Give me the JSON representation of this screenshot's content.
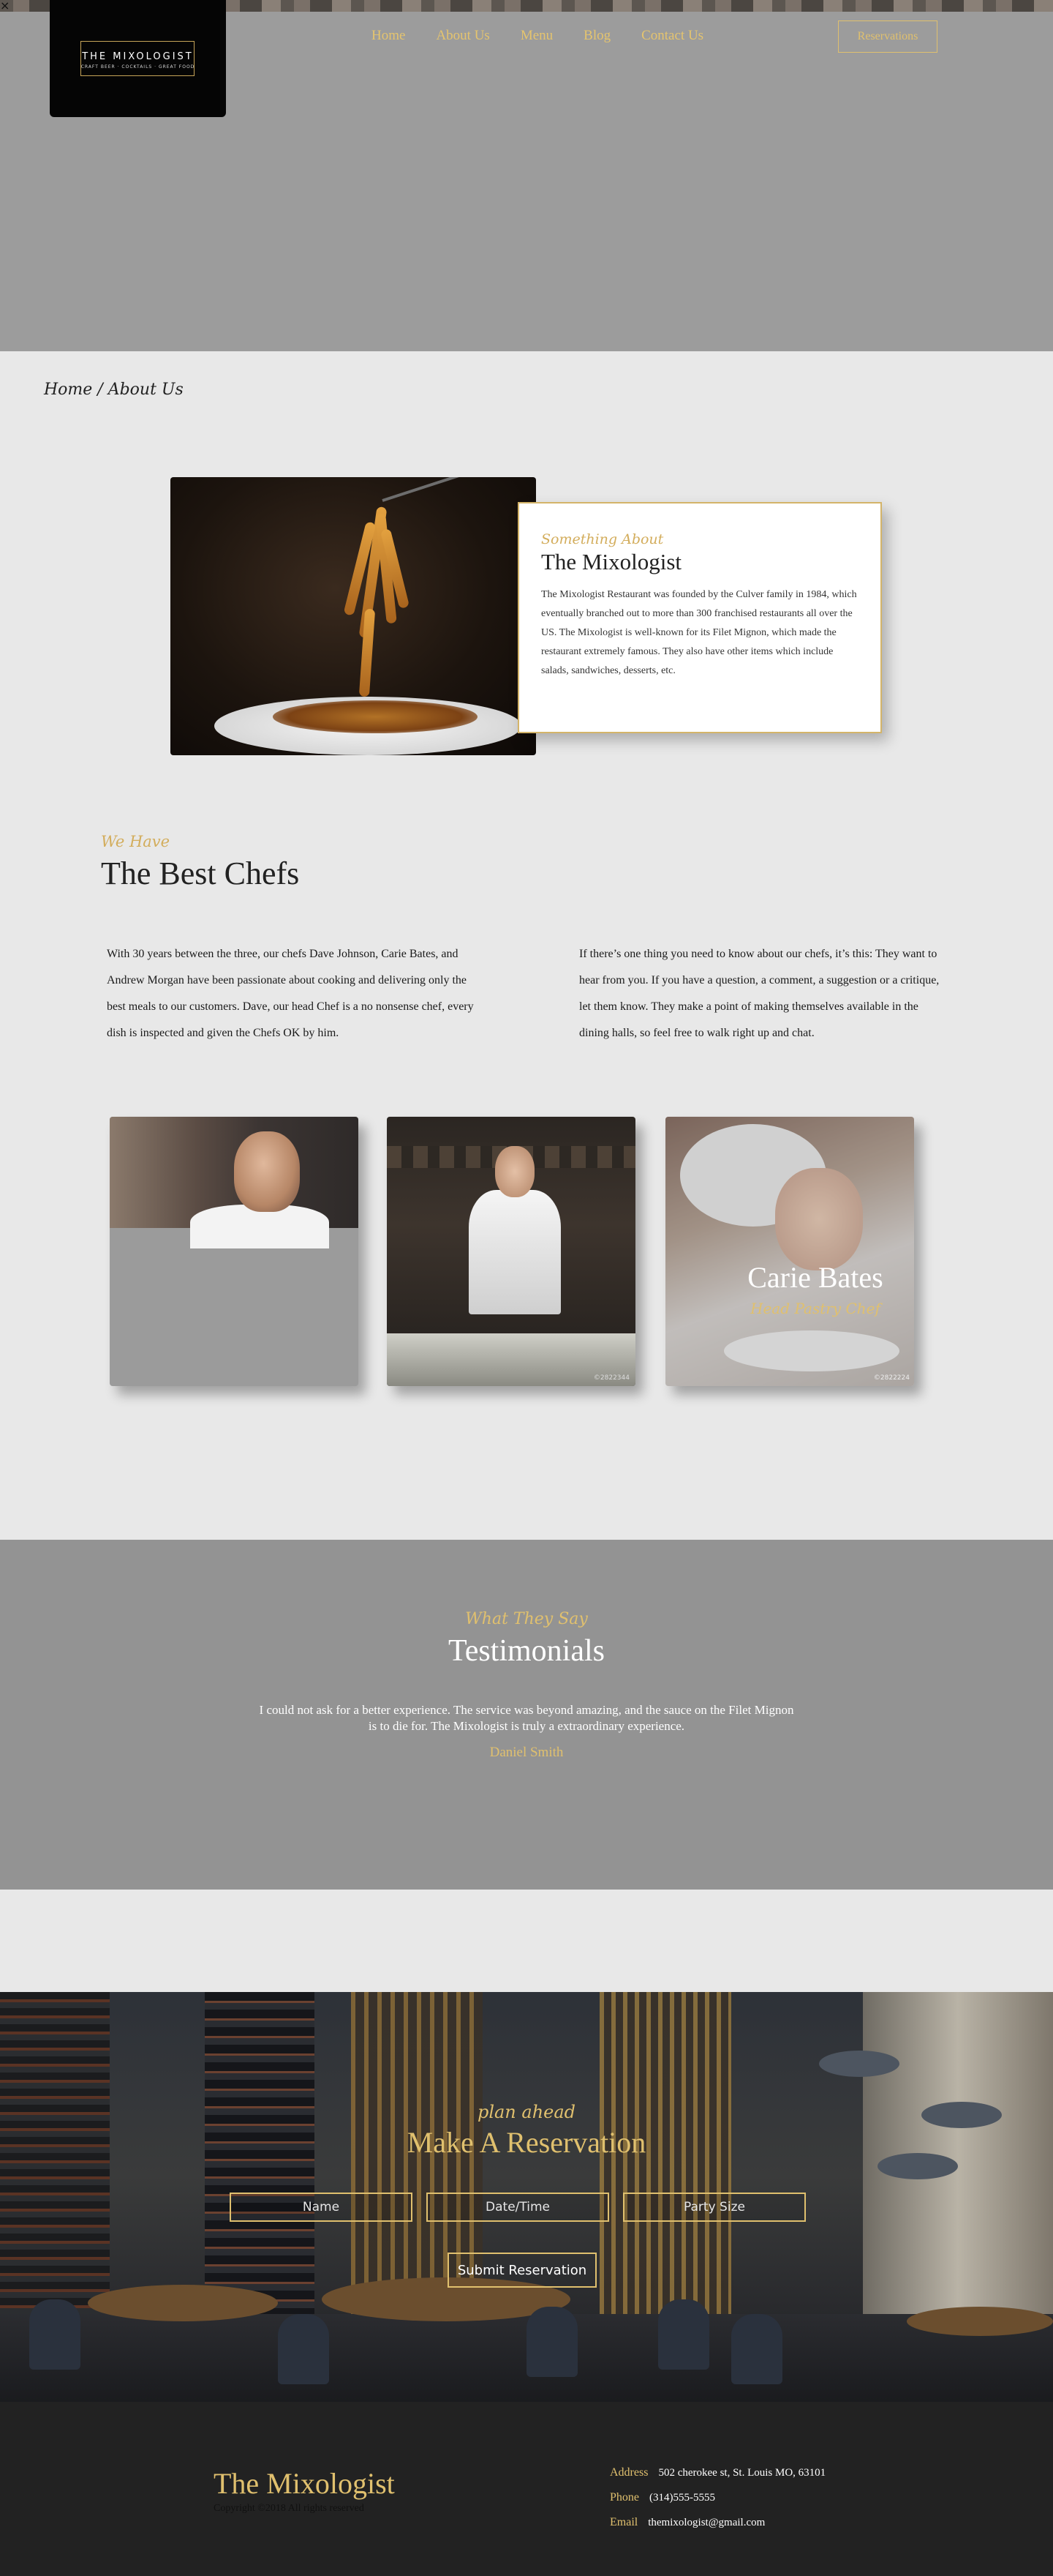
{
  "page": {
    "close_glyph": "×"
  },
  "logo": {
    "title": "THE MIXOLOGIST",
    "subtitle": "CRAFT BEER · COCKTAILS · GREAT FOOD"
  },
  "nav": {
    "items": [
      "Home",
      "About Us",
      "Menu",
      "Blog",
      "Contact Us"
    ],
    "reservations_label": "Reservations"
  },
  "breadcrumb": "Home / About Us",
  "about": {
    "kicker": "Something About",
    "title": "The Mixologist",
    "body": "The Mixologist Restaurant was founded by the Culver family in 1984, which eventually branched out to more than 300 franchised restaurants all over the US. The Mixologist is well-known for its Filet Mignon, which made the restaurant extremely famous. They also have other items which include salads, sandwiches, desserts, etc."
  },
  "chefs": {
    "kicker": "We Have",
    "title": "The Best Chefs",
    "para_left": "With 30 years between the three, our chefs Dave Johnson, Carie Bates, and Andrew Morgan have been passionate about cooking and delivering only the best meals to our customers. Dave, our head Chef is a no nonsense chef, every dish is inspected and given the Chefs OK by him.",
    "para_right": "If there’s one thing you need to know about our chefs, it’s this: They want to hear from you. If you have a question, a comment, a suggestion or a critique, let them know. They make a point of making themselves available in the dining halls, so feel free to walk right up and chat.",
    "cards": [
      {
        "name": "",
        "role": ""
      },
      {
        "name": "",
        "role": "",
        "watermark": "©2822344"
      },
      {
        "name": "Carie Bates",
        "role": "Head Pastry Chef",
        "watermark": "©2822224"
      }
    ]
  },
  "testimonials": {
    "kicker": "What They Say",
    "title": "Testimonials",
    "quote": "I could not ask for a better experience. The service was beyond amazing, and the sauce on the Filet Mignon is to die for. The Mixologist is truly a extraordinary experience.",
    "author": "Daniel Smith"
  },
  "reservation": {
    "kicker": "plan ahead",
    "title": "Make A Reservation",
    "fields": {
      "name": "Name",
      "datetime": "Date/Time",
      "party": "Party Size"
    },
    "submit_label": "Submit Reservation"
  },
  "footer": {
    "title": "The Mixologist",
    "copyright": "Copyright ©2018 All rights reserved",
    "address_label": "Address",
    "address": "502 cherokee st, St. Louis MO, 63101",
    "phone_label": "Phone",
    "phone": "(314)555-5555",
    "email_label": "Email",
    "email": "themixologist@gmail.com"
  },
  "colors": {
    "gold": "#e0c06e",
    "hero_bg": "#9c9c9c",
    "page_bg": "#e8e8e8",
    "footer_bg": "#222222"
  }
}
